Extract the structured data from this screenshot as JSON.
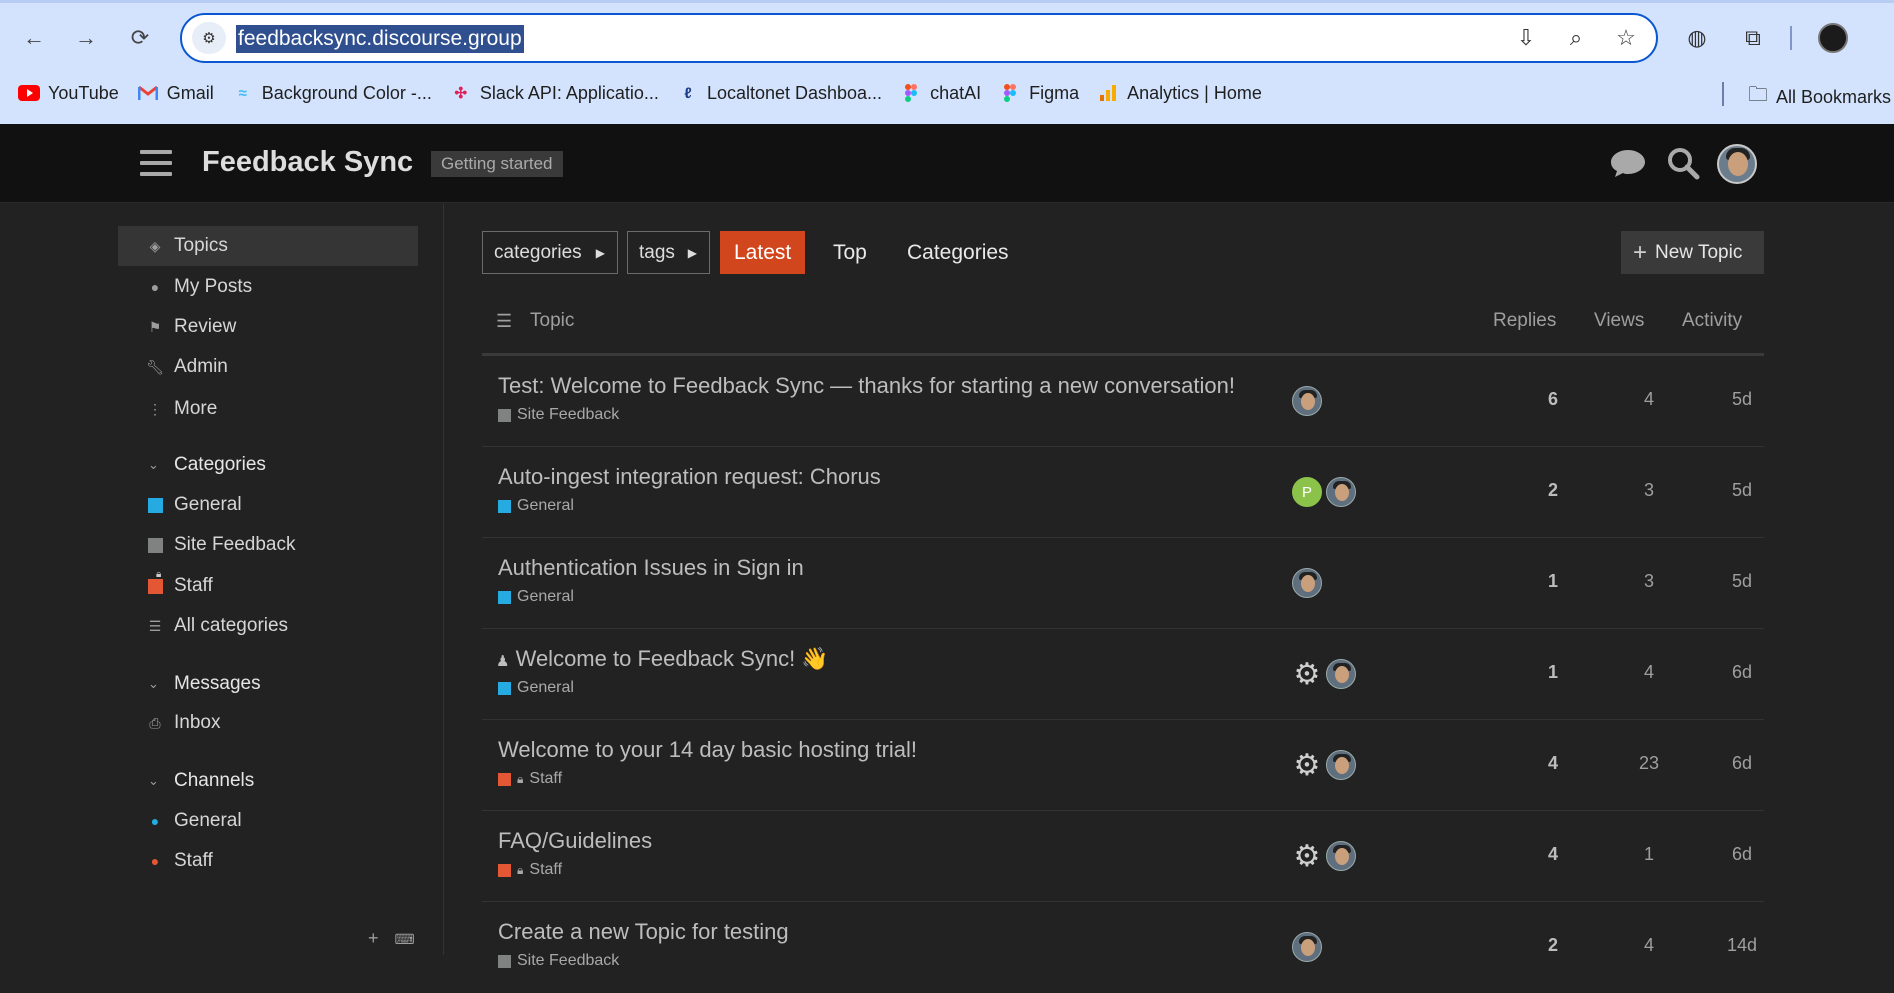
{
  "browser": {
    "url": "feedbacksync.discourse.group",
    "bookmarks": [
      {
        "label": "YouTube",
        "icon": "youtube-icon",
        "color": "#ff0000"
      },
      {
        "label": "Gmail",
        "icon": "gmail-icon",
        "color": "#ea4335"
      },
      {
        "label": "Background Color -...",
        "icon": "tailwind-icon",
        "color": "#38bdf8"
      },
      {
        "label": "Slack API: Applicatio...",
        "icon": "slack-icon",
        "color": "#e01e5a"
      },
      {
        "label": "Localtonet Dashboa...",
        "icon": "localtonet-icon",
        "color": "#1e3a8a"
      },
      {
        "label": "chatAI",
        "icon": "figma-icon",
        "color": "#f24e1e"
      },
      {
        "label": "Figma",
        "icon": "figma-icon",
        "color": "#a259ff"
      },
      {
        "label": "Analytics | Home",
        "icon": "analytics-icon",
        "color": "#f9ab00"
      }
    ],
    "all_bookmarks": "All Bookmarks"
  },
  "header": {
    "site_title": "Feedback Sync",
    "badge": "Getting started"
  },
  "sidebar": {
    "items": [
      {
        "label": "Topics",
        "icon": "layers-icon"
      },
      {
        "label": "My Posts",
        "icon": "user-icon"
      },
      {
        "label": "Review",
        "icon": "flag-icon"
      },
      {
        "label": "Admin",
        "icon": "wrench-icon"
      },
      {
        "label": "More",
        "icon": "ellipsis-vertical-icon"
      }
    ],
    "categories_title": "Categories",
    "categories": [
      {
        "label": "General",
        "color": "#25aae1"
      },
      {
        "label": "Site Feedback",
        "color": "#808281"
      },
      {
        "label": "Staff",
        "color": "#e45735"
      },
      {
        "label": "All categories",
        "color": ""
      }
    ],
    "messages_title": "Messages",
    "messages": [
      {
        "label": "Inbox"
      }
    ],
    "channels_title": "Channels",
    "channels": [
      {
        "label": "General",
        "color": "#25aae1"
      },
      {
        "label": "Staff",
        "color": "#e45735"
      }
    ]
  },
  "nav": {
    "categories_dropdown": "categories",
    "tags_dropdown": "tags",
    "latest": "Latest",
    "top": "Top",
    "categories": "Categories",
    "new_topic": "New Topic"
  },
  "table": {
    "headers": {
      "topic": "Topic",
      "replies": "Replies",
      "views": "Views",
      "activity": "Activity"
    },
    "rows": [
      {
        "title": "Test: Welcome to Feedback Sync — thanks for starting a new conversation!",
        "category": "Site Feedback",
        "cat_color": "#808281",
        "replies": "6",
        "views": "4",
        "activity": "5d"
      },
      {
        "title": "Auto-ingest integration request: Chorus",
        "category": "General",
        "cat_color": "#25aae1",
        "replies": "2",
        "views": "3",
        "activity": "5d"
      },
      {
        "title": "Authentication Issues in Sign in",
        "category": "General",
        "cat_color": "#25aae1",
        "replies": "1",
        "views": "3",
        "activity": "5d"
      },
      {
        "title": "Welcome to Feedback Sync! 👋",
        "category": "General",
        "cat_color": "#25aae1",
        "replies": "1",
        "views": "4",
        "activity": "6d"
      },
      {
        "title": "Welcome to your 14 day basic hosting trial!",
        "category": "Staff",
        "cat_color": "#e45735",
        "replies": "4",
        "views": "23",
        "activity": "6d"
      },
      {
        "title": "FAQ/Guidelines",
        "category": "Staff",
        "cat_color": "#e45735",
        "replies": "4",
        "views": "1",
        "activity": "6d"
      },
      {
        "title": "Create a new Topic for testing",
        "category": "Site Feedback",
        "cat_color": "#808281",
        "replies": "2",
        "views": "4",
        "activity": "14d"
      }
    ],
    "poster_initial": "P"
  }
}
